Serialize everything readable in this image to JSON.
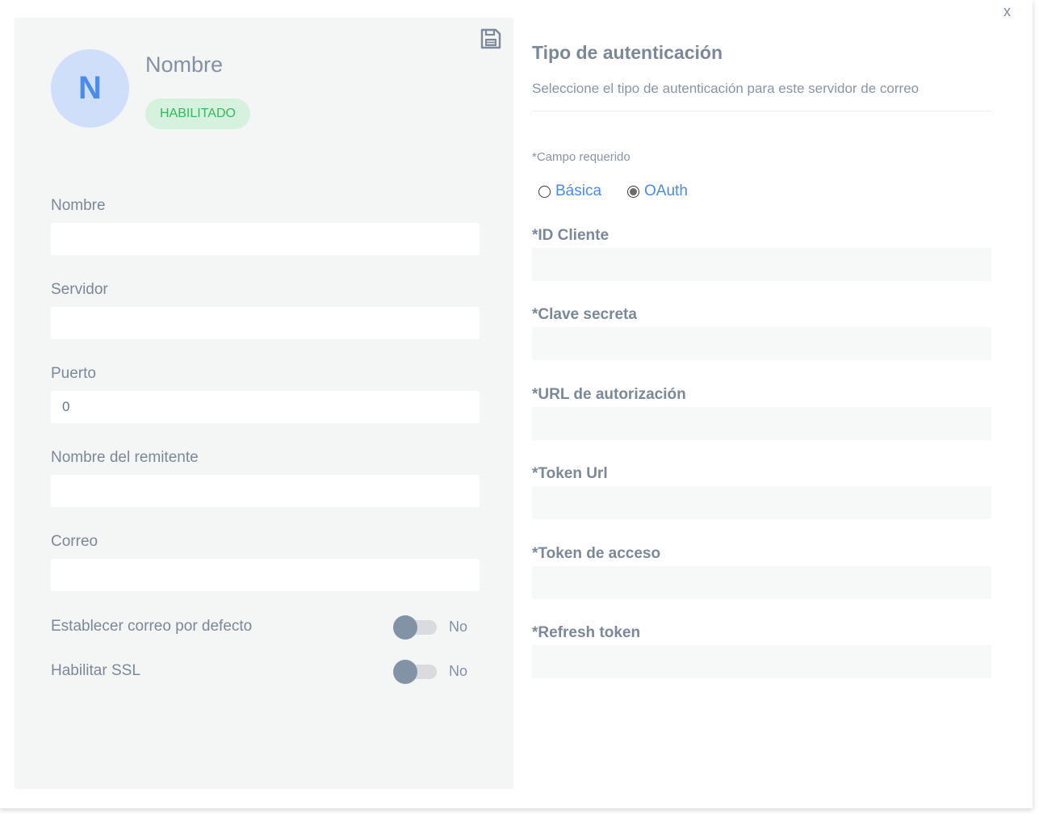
{
  "window": {
    "close_label": "x"
  },
  "colors": {
    "accent": "#4a8bf0",
    "enabled": "#2dbd5c",
    "panel": "#f4f5f5"
  },
  "icons": {
    "save": "save-icon",
    "close": "close-icon"
  },
  "profile": {
    "avatar_initial": "N",
    "name": "Nombre",
    "status": "HABILITADO"
  },
  "form": {
    "name_label": "Nombre",
    "name_value": "",
    "server_label": "Servidor",
    "server_value": "",
    "port_label": "Puerto",
    "port_value": "0",
    "sender_label": "Nombre del remitente",
    "sender_value": "",
    "email_label": "Correo",
    "email_value": "",
    "default_email_label": "Establecer correo por defecto",
    "default_email_state": "No",
    "ssl_label": "Habilitar SSL",
    "ssl_state": "No"
  },
  "auth": {
    "title": "Tipo de autenticación",
    "subtitle": "Seleccione el tipo de autenticación para este servidor de correo",
    "required_note": "*Campo requerido",
    "options": [
      {
        "label": "Básica",
        "selected": false
      },
      {
        "label": "OAuth",
        "selected": true
      }
    ],
    "fields": {
      "client_id_label": "*ID Cliente",
      "client_secret_label": "*Clave secreta",
      "auth_url_label": "*URL de autorización",
      "token_url_label": "*Token Url",
      "access_token_label": "*Token de acceso",
      "refresh_token_label": "*Refresh token"
    }
  }
}
